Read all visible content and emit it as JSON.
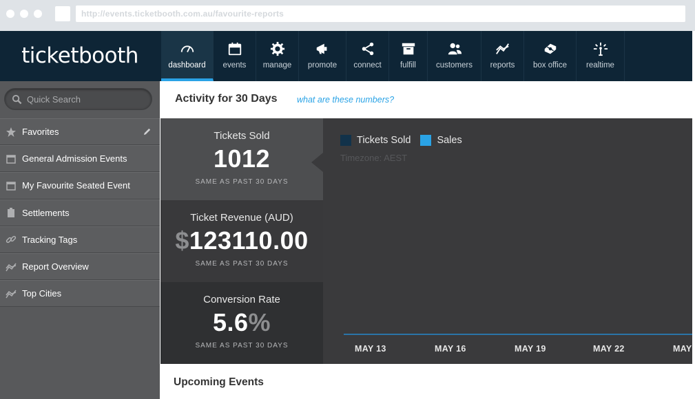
{
  "browser": {
    "url": "http://events.ticketbooth.com.au/favourite-reports"
  },
  "header": {
    "logo": "ticketbooth",
    "nav": [
      {
        "label": "dashboard",
        "icon": "gauge-icon",
        "active": true
      },
      {
        "label": "events",
        "icon": "calendar-icon",
        "active": false
      },
      {
        "label": "manage",
        "icon": "gear-icon",
        "active": false
      },
      {
        "label": "promote",
        "icon": "megaphone-icon",
        "active": false
      },
      {
        "label": "connect",
        "icon": "share-icon",
        "active": false
      },
      {
        "label": "fulfill",
        "icon": "archive-box-icon",
        "active": false
      },
      {
        "label": "customers",
        "icon": "people-icon",
        "active": false
      },
      {
        "label": "reports",
        "icon": "trend-icon",
        "active": false
      },
      {
        "label": "box office",
        "icon": "ticket-booth-icon",
        "active": false
      },
      {
        "label": "realtime",
        "icon": "broadcast-icon",
        "active": false
      }
    ]
  },
  "sidebar": {
    "search_placeholder": "Quick Search",
    "items": [
      {
        "label": "Favorites",
        "icon": "star-icon"
      },
      {
        "label": "General Admission Events",
        "icon": "calendar-icon"
      },
      {
        "label": "My Favourite Seated Event",
        "icon": "calendar-icon"
      },
      {
        "label": "Settlements",
        "icon": "clipboard-icon"
      },
      {
        "label": "Tracking Tags",
        "icon": "link-icon"
      },
      {
        "label": "Report Overview",
        "icon": "trend-icon"
      },
      {
        "label": "Top Cities",
        "icon": "trend-icon"
      }
    ]
  },
  "activity": {
    "title": "Activity for 30 Days",
    "help_link": "what are these numbers?"
  },
  "stats": [
    {
      "label": "Tickets Sold",
      "prefix": "",
      "value": "1012",
      "suffix": "",
      "note": "SAME AS PAST 30 DAYS"
    },
    {
      "label": "Ticket Revenue (AUD)",
      "prefix": "$",
      "value": "123110.00",
      "suffix": "",
      "note": "SAME AS PAST 30 DAYS"
    },
    {
      "label": "Conversion Rate",
      "prefix": "",
      "value": "5.6",
      "suffix": "%",
      "note": "SAME AS PAST 30 DAYS"
    }
  ],
  "chart_data": {
    "type": "line",
    "title": "",
    "xlabel": "",
    "ylabel": "",
    "x_ticks": [
      "MAY 13",
      "MAY 16",
      "MAY 19",
      "MAY 22",
      "MAY"
    ],
    "series": [
      {
        "name": "Tickets Sold",
        "color": "#12324a"
      },
      {
        "name": "Sales",
        "color": "#2aa3e6"
      }
    ],
    "timezone_note": "Timezone: AEST",
    "grid": false,
    "legend": "top-left"
  },
  "upcoming": {
    "title": "Upcoming Events"
  },
  "colors": {
    "header_bg": "#0e2536",
    "accent": "#2aa3e6",
    "sidebar_bg": "#58595b",
    "chart_bg": "#3a3a3c"
  }
}
